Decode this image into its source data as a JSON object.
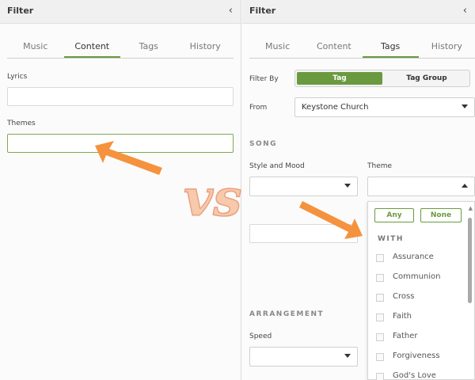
{
  "left": {
    "title": "Filter",
    "collapse_glyph": "‹",
    "tabs": [
      "Music",
      "Content",
      "Tags",
      "History"
    ],
    "active_tab": 1,
    "lyrics_label": "Lyrics",
    "themes_label": "Themes"
  },
  "right": {
    "title": "Filter",
    "collapse_glyph": "‹",
    "tabs": [
      "Music",
      "Content",
      "Tags",
      "History"
    ],
    "active_tab": 2,
    "filter_by_label": "Filter By",
    "filter_options": [
      "Tag",
      "Tag Group"
    ],
    "from_label": "From",
    "from_value": "Keystone Church",
    "song_section": "SONG",
    "style_mood_label": "Style and Mood",
    "theme_label": "Theme",
    "arrangement_section": "ARRANGEMENT",
    "speed_label": "Speed",
    "dropdown": {
      "any_label": "Any",
      "none_label": "None",
      "with_label": "WITH",
      "items": [
        "Assurance",
        "Communion",
        "Cross",
        "Faith",
        "Father",
        "Forgiveness",
        "God's Love"
      ]
    }
  },
  "overlay_text": "vs",
  "colors": {
    "accent_green": "#6a9a3f",
    "arrow_orange": "#f5923e",
    "vs_fill": "#f7c9ad"
  }
}
